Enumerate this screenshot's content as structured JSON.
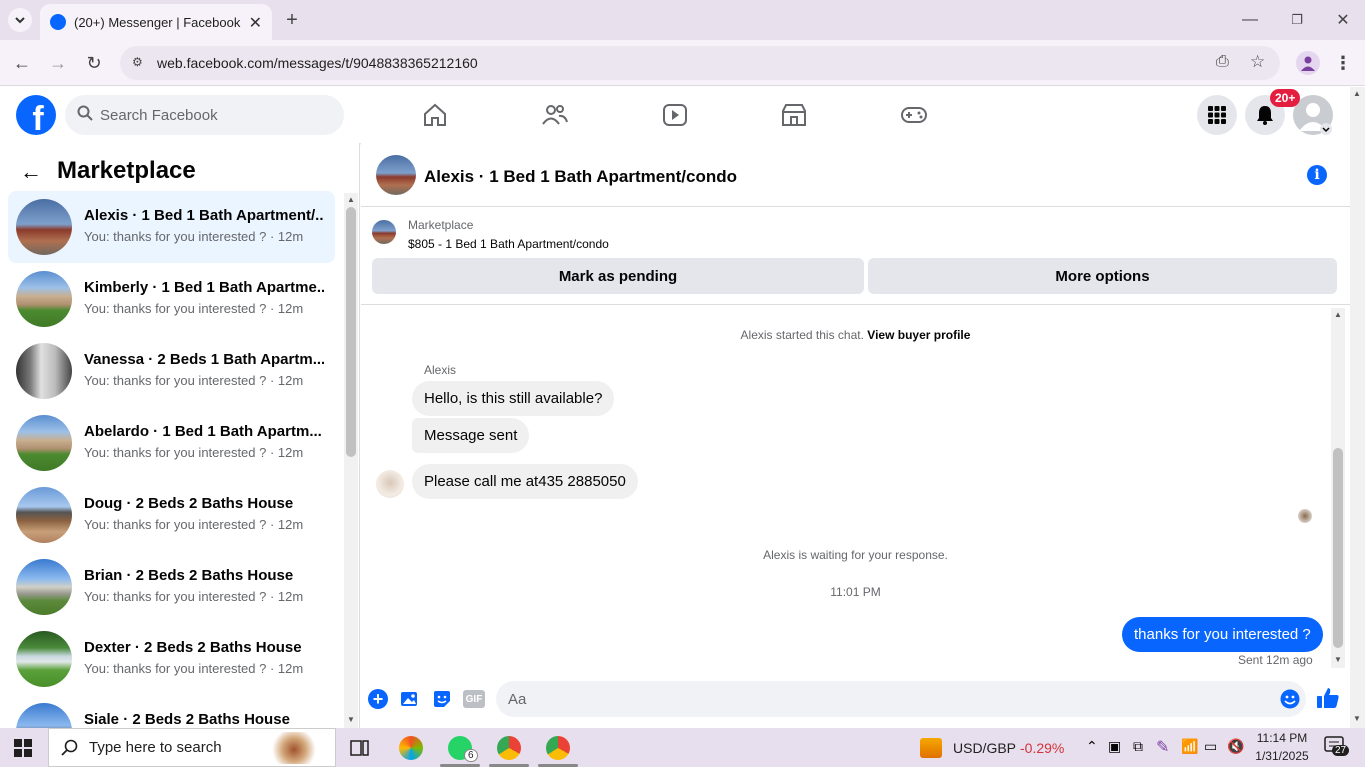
{
  "browser": {
    "tab_title": "(20+) Messenger | Facebook",
    "url": "web.facebook.com/messages/t/9048838365212160"
  },
  "fb_header": {
    "search_placeholder": "Search Facebook",
    "notifications_badge": "20+"
  },
  "sidebar": {
    "title": "Marketplace",
    "conversations": [
      {
        "title": "Alexis · 1 Bed 1 Bath Apartment/...",
        "snippet": "You: thanks for you interested ? · 12m",
        "active": true
      },
      {
        "title": "Kimberly · 1 Bed 1 Bath Apartme...",
        "snippet": "You: thanks for you interested ? · 12m"
      },
      {
        "title": "Vanessa · 2 Beds 1 Bath Apartm...",
        "snippet": "You: thanks for you interested ? · 12m"
      },
      {
        "title": "Abelardo · 1 Bed 1 Bath Apartm...",
        "snippet": "You: thanks for you interested ? · 12m"
      },
      {
        "title": "Doug · 2 Beds 2 Baths House",
        "snippet": "You: thanks for you interested ? · 12m"
      },
      {
        "title": "Brian · 2 Beds 2 Baths House",
        "snippet": "You: thanks for you interested ? · 12m"
      },
      {
        "title": "Dexter · 2 Beds 2 Baths House",
        "snippet": "You: thanks for you interested ? · 12m"
      },
      {
        "title": "Siale · 2 Beds 2 Baths House",
        "snippet": ""
      }
    ]
  },
  "chat": {
    "header_title": "Alexis · 1 Bed 1 Bath Apartment/condo",
    "marketplace_label": "Marketplace",
    "listing": "$805 - 1 Bed 1 Bath Apartment/condo",
    "mark_pending": "Mark as pending",
    "more_options": "More options",
    "started_text": "Alexis started this chat.",
    "view_profile": "View buyer profile",
    "sender_name": "Alexis",
    "messages": [
      "Hello, is this still available?",
      "Message sent",
      "Please call me at435 2885050"
    ],
    "waiting_text": "Alexis is waiting for your response.",
    "timestamp": "11:01 PM",
    "my_message": "thanks for you interested ?",
    "sent_status": "Sent 12m ago",
    "input_placeholder": "Aa"
  },
  "taskbar": {
    "search_placeholder": "Type here to search",
    "currency": "USD/GBP",
    "currency_change": "-0.29%",
    "time": "11:14 PM",
    "date": "1/31/2025",
    "whatsapp_badge": "6",
    "notif_count": "27"
  },
  "colors": {
    "fb_blue": "#0866ff",
    "badge_red": "#e41e3f",
    "negative": "#d13438"
  }
}
